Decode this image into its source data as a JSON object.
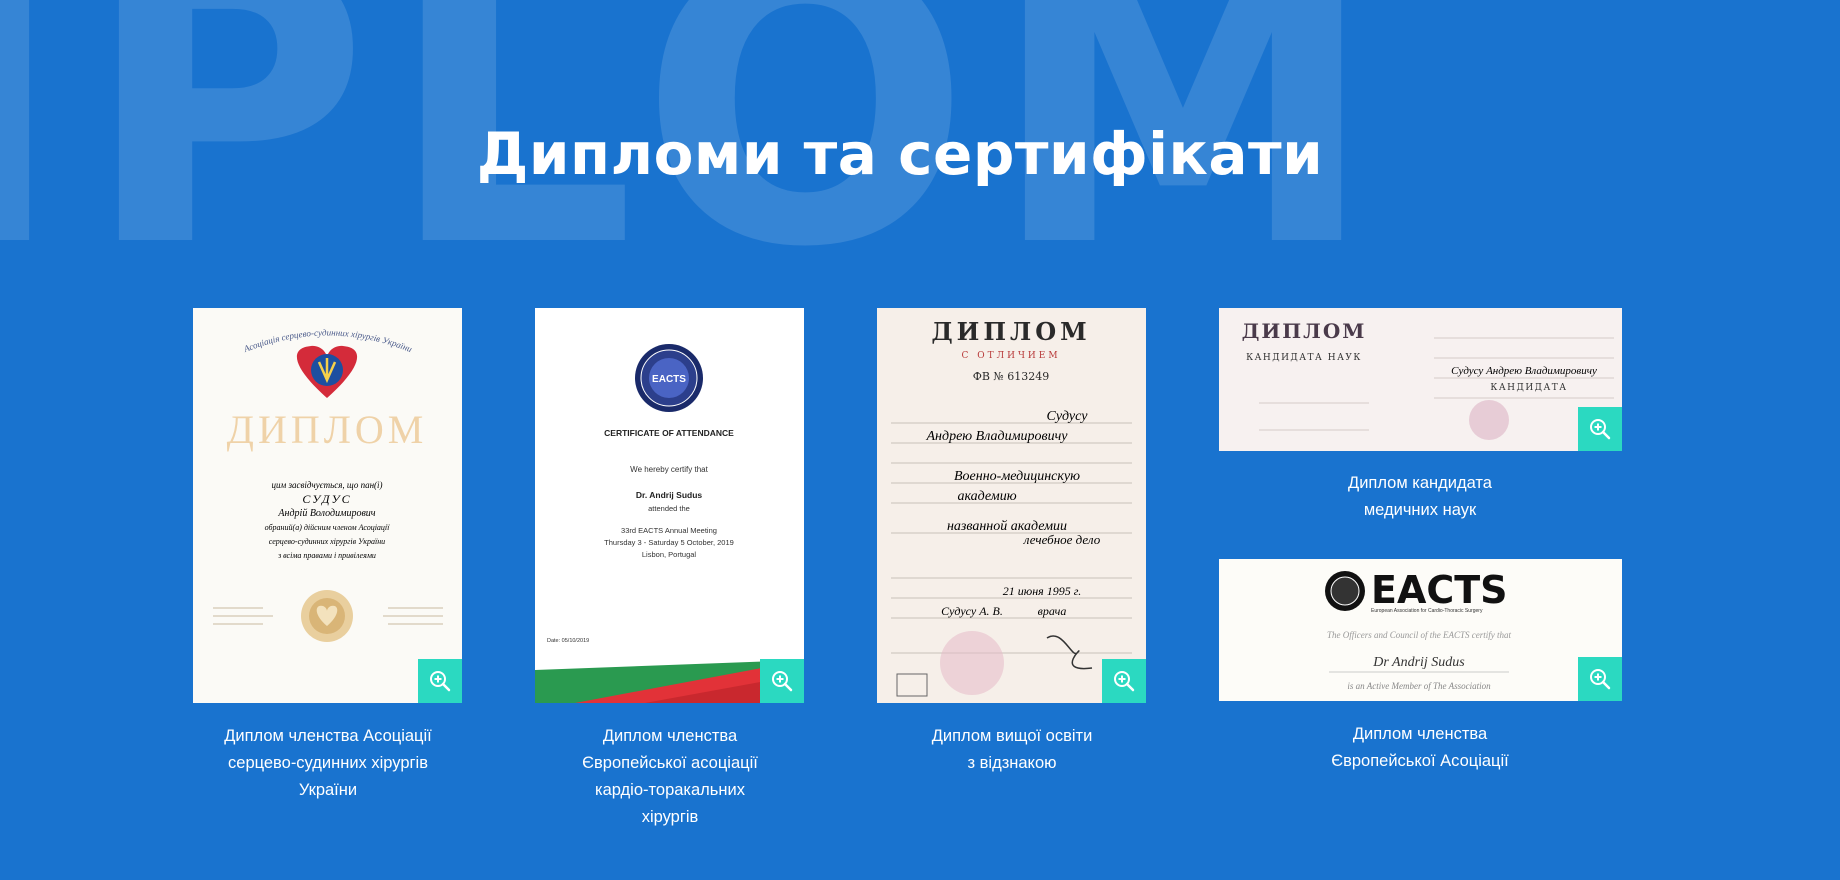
{
  "background_word": "IPLOM",
  "section_title": "Дипломи та сертифікати",
  "colors": {
    "background": "#1973cf",
    "zoom_button": "#2bd9c1"
  },
  "icons": {
    "zoom": "zoom-in-icon"
  },
  "cards": [
    {
      "caption_lines": [
        "Диплом членства Асоціації",
        "серцево-судинних хірургів",
        "України"
      ],
      "doc": {
        "arc": "Асоціація серцево-судинних хірургів України",
        "heading": "ДИПЛОМ",
        "line1": "цим засвідчується, що пан(і)",
        "name": "СУДУС",
        "given": "Андрій Володимирович",
        "l2": "обраний(а) дійсним членом Асоціації",
        "l3": "серцево-судинних хірургів України",
        "l4": "з всіма правами і привілеями"
      }
    },
    {
      "caption_lines": [
        "Диплом членства",
        "Європейської асоціації",
        "кардіо-торакальних",
        "хірургів"
      ],
      "doc": {
        "logo": "EACTS",
        "heading": "CERTIFICATE OF ATTENDANCE",
        "certify": "We hereby certify that",
        "name": "Dr. Andrij Sudus",
        "attended": "attended the",
        "event": "33rd EACTS Annual Meeting",
        "dates": "Thursday 3 - Saturday 5 October, 2019",
        "place": "Lisbon, Portugal",
        "date": "Date: 05/10/2019"
      }
    },
    {
      "caption_lines": [
        "Диплом вищої освіти",
        "з відзнакою"
      ],
      "doc": {
        "heading": "ДИПЛОМ",
        "sub": "С ОТЛИЧИЕМ",
        "number": "ФВ  № 613249",
        "hw1": "Судусу",
        "hw2": "Андрею Владимировичу",
        "hw3": "Военно-медицинскую",
        "hw4": "академию",
        "hw5": "названной академии",
        "hw6": "лечебное дело",
        "hw7": "21  июня   1995 г.",
        "hw8": "Судусу  А. В.",
        "hw9": "врача"
      }
    },
    {
      "caption_lines": [
        "Диплом кандидата",
        "медичних наук"
      ],
      "doc": {
        "heading": "ДИПЛОМ",
        "sub": "КАНДИДАТА НАУК",
        "right": "КАНДИДАТА",
        "hw": "Судусу Андрею Владимировичу"
      }
    },
    {
      "caption_lines": [
        "Диплом членства",
        "Європейської Асоціації"
      ],
      "doc": {
        "logo": "EACTS",
        "logo_sub": "European Association for Cardio-Thoracic Surgery",
        "line": "The Officers and Council of the EACTS certify that",
        "name": "Dr Andrij Sudus",
        "member": "is an Active Member of The Association"
      }
    }
  ]
}
